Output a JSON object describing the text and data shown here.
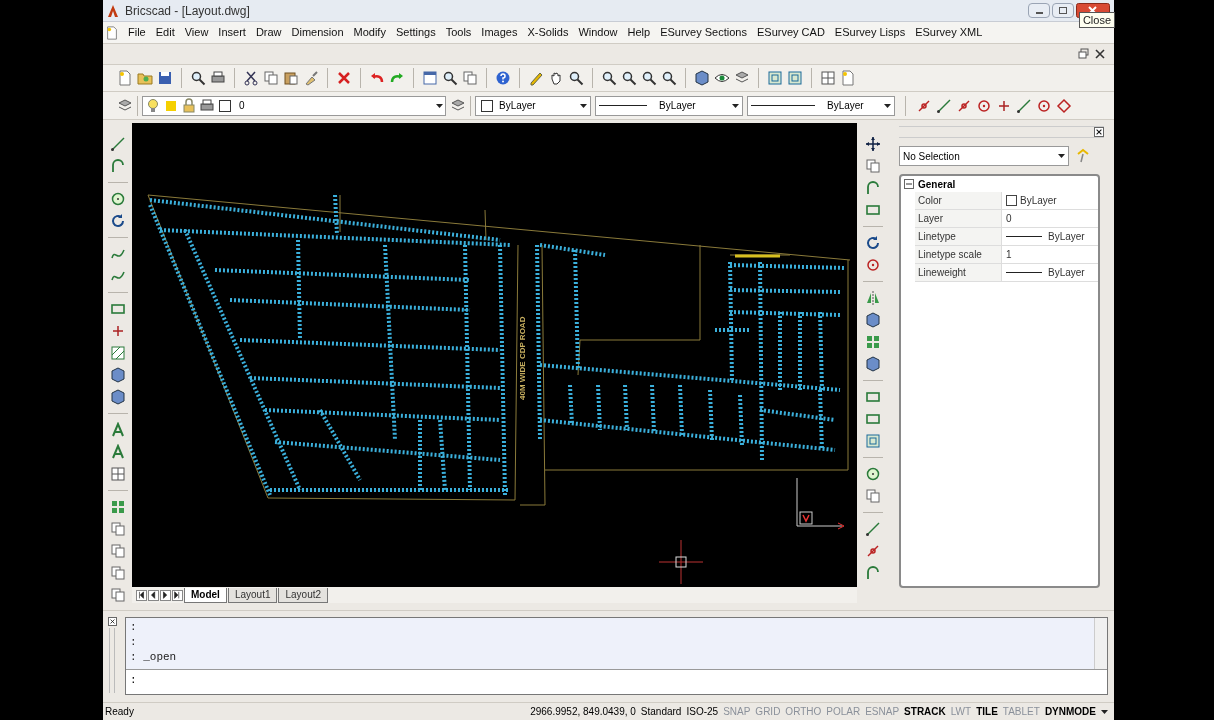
{
  "window": {
    "title": "Bricscad - [Layout.dwg]",
    "tooltip": "Close"
  },
  "menu": [
    "File",
    "Edit",
    "View",
    "Insert",
    "Draw",
    "Dimension",
    "Modify",
    "Settings",
    "Tools",
    "Images",
    "X-Solids",
    "Window",
    "Help",
    "ESurvey Sections",
    "ESurvey CAD",
    "ESurvey Lisps",
    "ESurvey XML"
  ],
  "layer_bar": {
    "layer": "0",
    "color_setting": "ByLayer",
    "linetype": "ByLayer",
    "lineweight": "ByLayer"
  },
  "drawing": {
    "road_label": "40M WIDE CDP ROAD"
  },
  "layout_tabs": [
    {
      "label": "Model",
      "selected": true
    },
    {
      "label": "Layout1",
      "selected": false
    },
    {
      "label": "Layout2",
      "selected": false
    }
  ],
  "properties": {
    "selection": "No Selection",
    "section": "General",
    "rows": [
      {
        "name": "Color",
        "value": "ByLayer",
        "kind": "color"
      },
      {
        "name": "Layer",
        "value": "0",
        "kind": "text"
      },
      {
        "name": "Linetype",
        "value": "ByLayer",
        "kind": "line"
      },
      {
        "name": "Linetype scale",
        "value": "1",
        "kind": "text"
      },
      {
        "name": "Lineweight",
        "value": "ByLayer",
        "kind": "line"
      }
    ]
  },
  "command_line": {
    "history": [
      ":",
      ":",
      ": _open"
    ],
    "prompt": ":"
  },
  "status_bar": {
    "message": "Ready",
    "coordinates": "2966.9952, 849.0439, 0",
    "text_style": "Standard",
    "dim_style": "ISO-25",
    "toggles": [
      {
        "label": "SNAP",
        "on": false
      },
      {
        "label": "GRID",
        "on": false
      },
      {
        "label": "ORTHO",
        "on": false
      },
      {
        "label": "POLAR",
        "on": false
      },
      {
        "label": "ESNAP",
        "on": false
      },
      {
        "label": "STRACK",
        "on": true
      },
      {
        "label": "LWT",
        "on": false
      },
      {
        "label": "TILE",
        "on": true
      },
      {
        "label": "TABLET",
        "on": false
      },
      {
        "label": "DYNMODE",
        "on": true
      }
    ]
  }
}
